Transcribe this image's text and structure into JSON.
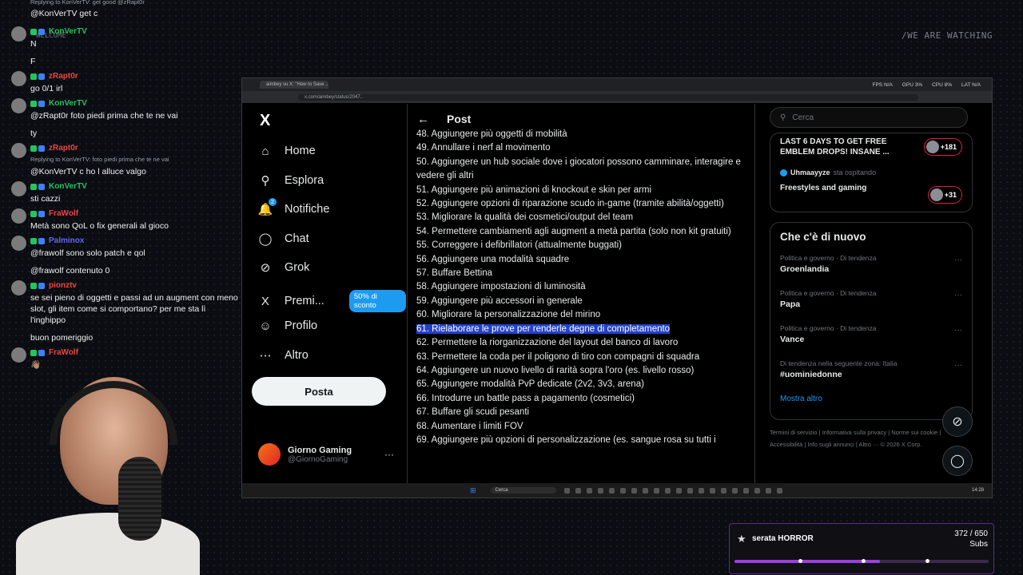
{
  "overlay": {
    "watermark": "/WE ARE WATCHING",
    "welcome": "WELCOME"
  },
  "chat": {
    "top_reply": "Replying to KonVerTV: get good @zRapt0r",
    "top_text": "@KonVerTV get c",
    "messages": [
      {
        "user": "KonVerTV",
        "color": "#22c55e",
        "lines": [
          "N",
          "F"
        ]
      },
      {
        "user": "zRapt0r",
        "color": "#ef4444",
        "lines": [
          "go 0/1 irl"
        ]
      },
      {
        "user": "KonVerTV",
        "color": "#22c55e",
        "lines": [
          "@zRapt0r foto piedi prima che te ne vai",
          "ty"
        ]
      },
      {
        "user": "zRapt0r",
        "color": "#ef4444",
        "reply": "Replying to KonVerTV: foto piedi prima che te ne vai",
        "lines": [
          "@KonVerTV c ho l alluce valgo"
        ]
      },
      {
        "user": "KonVerTV",
        "color": "#22c55e",
        "lines": [
          "sti cazzi"
        ]
      },
      {
        "user": "FraWolf",
        "color": "#ef4444",
        "lines": [
          "Metà sono QoL o fix generali al gioco"
        ]
      },
      {
        "user": "Palminox",
        "color": "#6366f1",
        "lines": [
          "@frawolf sono solo patch e qol",
          "@frawolf contenuto 0"
        ]
      },
      {
        "user": "pionztv",
        "color": "#ef4444",
        "lines": [
          "se sei pieno di oggetti e passi ad un augment con meno slot, gli item come si comportano? per me sta lì l'inghippo",
          "buon pomeriggio"
        ]
      },
      {
        "user": "FraWolf",
        "color": "#ef4444",
        "lines": [
          "👋🏽"
        ]
      }
    ]
  },
  "browser": {
    "tab_title": "aimbey su X: \"How to Save ...",
    "url": "x.com/aimbey/status/2047..",
    "stats": {
      "fps": "FPS N/A",
      "gpu": "GPU 3%",
      "cpu": "CPU 8%",
      "lat": "LAT N/A"
    }
  },
  "nav": {
    "logo": "X",
    "items": [
      {
        "label": "Home",
        "icon": "home-icon",
        "glyph": "⌂"
      },
      {
        "label": "Esplora",
        "icon": "search-icon",
        "glyph": "⚲"
      },
      {
        "label": "Notifiche",
        "icon": "bell-icon",
        "glyph": "🔔",
        "badge": "2"
      },
      {
        "label": "Chat",
        "icon": "chat-icon",
        "glyph": "◯"
      },
      {
        "label": "Grok",
        "icon": "grok-icon",
        "glyph": "⊘"
      },
      {
        "label": "Premi...",
        "icon": "x-premium-icon",
        "glyph": "X",
        "promo": "50% di sconto"
      },
      {
        "label": "Profilo",
        "icon": "person-icon",
        "glyph": "☺"
      },
      {
        "label": "Altro",
        "icon": "more-circle-icon",
        "glyph": "⋯"
      }
    ],
    "post_button": "Posta",
    "account": {
      "name": "Giorno Gaming",
      "handle": "@GiornoGaming",
      "more": "···"
    }
  },
  "post": {
    "title": "Post",
    "items": [
      "48. Aggiungere più oggetti di mobilità",
      "49. Annullare i nerf al movimento",
      "50. Aggiungere un hub sociale dove i giocatori possono camminare, interagire e vedere gli altri",
      "51. Aggiungere più animazioni di knockout e skin per armi",
      "52. Aggiungere opzioni di riparazione scudo in-game (tramite abilità/oggetti)",
      "53. Migliorare la qualità dei cosmetici/output del team",
      "54. Permettere cambiamenti agli augment a metà partita (solo non kit gratuiti)",
      "55. Correggere i defibrillatori (attualmente buggati)",
      "56. Aggiungere una modalità squadre",
      "57. Buffare Bettina",
      "58. Aggiungere impostazioni di luminosità",
      "59. Aggiungere più accessori in generale",
      "60. Migliorare la personalizzazione del mirino",
      "61. Rielaborare le prove per renderle degne di completamento",
      "62. Permettere la riorganizzazione del layout del banco di lavoro",
      "63. Permettere la coda per il poligono di tiro con compagni di squadra",
      "64. Aggiungere un nuovo livello di rarità sopra l'oro (es. livello rosso)",
      "65. Aggiungere modalità PvP dedicate (2v2, 3v3, arena)",
      "66. Introdurre un battle pass a pagamento (cosmetici)",
      "67. Buffare gli scudi pesanti",
      "68. Aumentare i limiti FOV",
      "69. Aggiungere più opzioni di personalizzazione (es. sangue rosa su tutti i"
    ],
    "highlighted_index": 13
  },
  "sidebar": {
    "search_placeholder": "Cerca",
    "live": {
      "title": "LAST 6 DAYS TO GET FREE EMBLEM DROPS! INSANE ...",
      "count1": "+181",
      "host_name": "Uhmaayyze",
      "host_suffix": "sta ospitando",
      "space_title": "Freestyles and gaming",
      "count2": "+31"
    },
    "whats_new": {
      "heading": "Che c'è di nuovo",
      "trends": [
        {
          "meta": "Politica e governo · Di tendenza",
          "topic": "Groenlandia"
        },
        {
          "meta": "Politica e governo · Di tendenza",
          "topic": "Papa"
        },
        {
          "meta": "Politica e governo · Di tendenza",
          "topic": "Vance"
        },
        {
          "meta": "Di tendenza nella seguente zona: Italia",
          "topic": "#uominiedonne"
        }
      ],
      "show_more": "Mostra altro"
    },
    "footer": "Termini di servizio | Informativa sulla privacy | Norme sui cookie | Accessibilità | Info sugli annunci | Altro ··· © 2026 X Corp."
  },
  "taskbar": {
    "search": "Cerca",
    "clock": "14:28"
  },
  "goal": {
    "title": "serata HORROR",
    "count": "372 / 650",
    "unit": "Subs",
    "progress": 0.572
  }
}
